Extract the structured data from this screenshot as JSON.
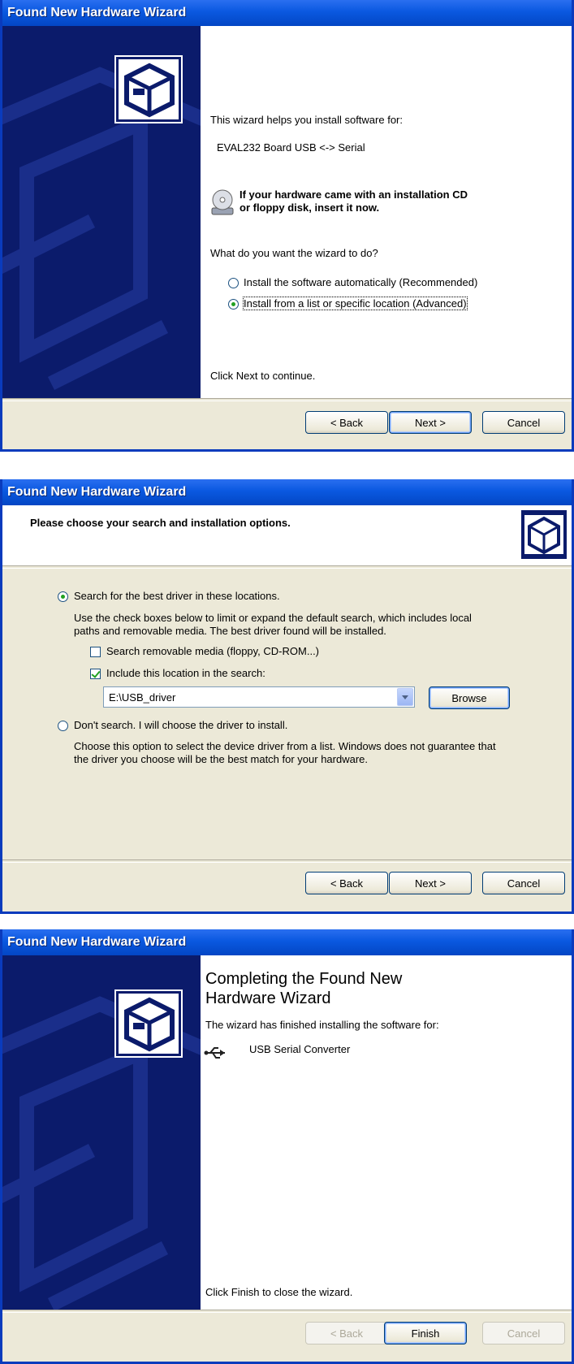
{
  "window1": {
    "title": "Found New Hardware Wizard",
    "intro": "This wizard helps you install software for:",
    "device": "EVAL232 Board USB <-> Serial",
    "cd_prompt_line1": "If your hardware came with an installation CD",
    "cd_prompt_line2": "or floppy disk, insert it now.",
    "question": "What do you want the wizard to do?",
    "option_auto": "Install the software automatically (Recommended)",
    "option_advanced": "Install from a list or specific location (Advanced)",
    "selected_option": "option_advanced",
    "continue_text": "Click Next to continue.",
    "back_label": "< Back",
    "next_label": "Next >",
    "cancel_label": "Cancel"
  },
  "window2": {
    "title": "Found New Hardware Wizard",
    "heading": "Please choose your search and installation options.",
    "option_search": "Search for the best driver in these locations.",
    "search_desc_line1": "Use the check boxes below to limit or expand the default search, which includes local",
    "search_desc_line2": "paths and removable media. The best driver found will be installed.",
    "check_removable": "Search removable media (floppy, CD-ROM...)",
    "check_removable_checked": false,
    "check_location": "Include this location in the search:",
    "check_location_checked": true,
    "location_value": "E:\\USB_driver",
    "browse_label": "Browse",
    "option_dont_search": "Don't search. I will choose the driver to install.",
    "dont_desc_line1": "Choose this option to select the device driver from a list.  Windows does not guarantee that",
    "dont_desc_line2": "the driver you choose will be the best match for your hardware.",
    "selected_option": "option_search",
    "back_label": "< Back",
    "next_label": "Next >",
    "cancel_label": "Cancel"
  },
  "window3": {
    "title": "Found New Hardware Wizard",
    "heading_line1": "Completing the Found New",
    "heading_line2": "Hardware Wizard",
    "finished_text": "The wizard has finished installing the software for:",
    "device": "USB Serial Converter",
    "close_text": "Click Finish to close the wizard.",
    "back_label": "< Back",
    "finish_label": "Finish",
    "cancel_label": "Cancel"
  },
  "icons": {
    "hardware": "hardware-wizard-icon",
    "cd": "cd-drive-icon",
    "usb": "usb-icon"
  },
  "colors": {
    "titlebar": "#0a58e0",
    "sidebar": "#0b1b6b",
    "dialog_bg": "#ece9d8",
    "radio_dot": "#21a121"
  }
}
